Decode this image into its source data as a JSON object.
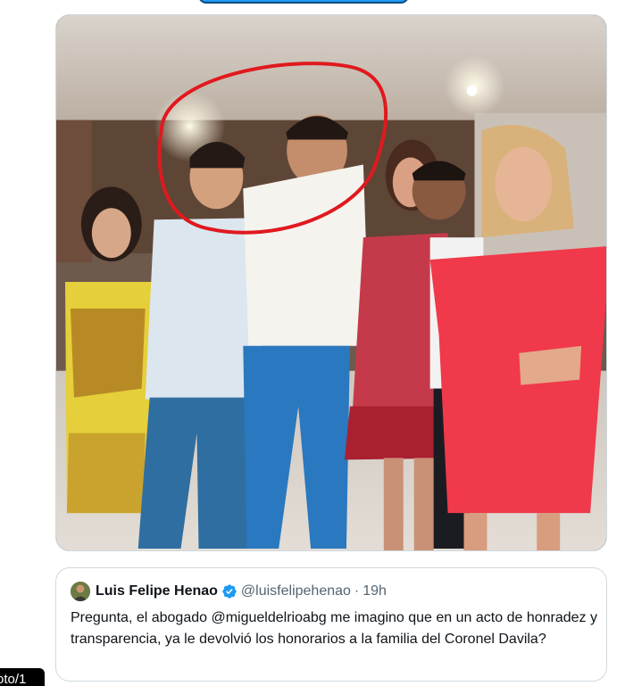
{
  "tweet": {
    "photo": {
      "alt_icon": "group-photo",
      "highlight_color": "#e0191f"
    }
  },
  "quoted_tweet": {
    "display_name": "Luis Felipe Henao",
    "verified_icon": "verified-badge-icon",
    "handle": "@luisfelipehenao",
    "separator": "·",
    "time": "19h",
    "text": "Pregunta, el abogado @migueldelrioabg me imagino que en un acto de honradez y transparencia, ya le devolvió los honorarios a la familia del Coronel Davila?"
  },
  "photo_counter": {
    "label": "oto/1"
  },
  "colors": {
    "accent": "#1d9bf0",
    "border": "#cfd9de",
    "text_primary": "#0f1419",
    "text_secondary": "#536471"
  }
}
